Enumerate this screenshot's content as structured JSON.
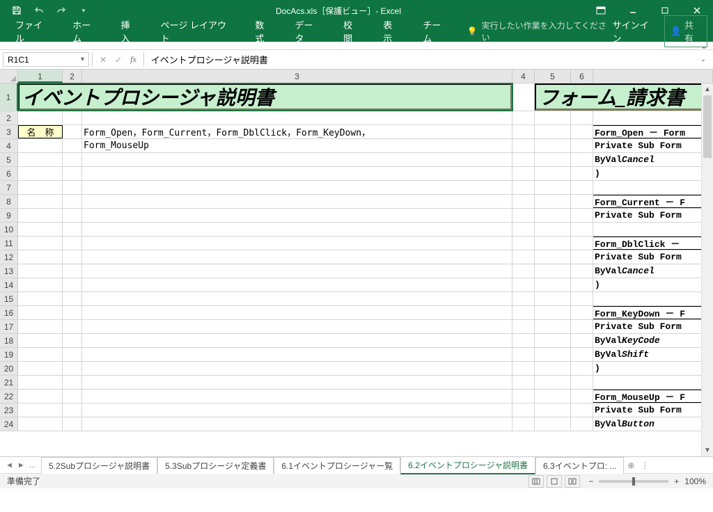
{
  "app": {
    "title": "DocAcs.xls［保護ビュー］- Excel",
    "signin": "サインイン",
    "share": "共有"
  },
  "ribbon": {
    "tabs": [
      "ファイル",
      "ホーム",
      "挿入",
      "ページ レイアウト",
      "数式",
      "データ",
      "校閲",
      "表示",
      "チーム"
    ],
    "tellme": "実行したい作業を入力してください"
  },
  "namebox": {
    "value": "R1C1"
  },
  "formula": {
    "value": "イベントプロシージャ説明書"
  },
  "columns": [
    "1",
    "2",
    "3",
    "4",
    "5",
    "6",
    ""
  ],
  "row_count": 24,
  "cells": {
    "title_main": "イベントプロシージャ説明書",
    "title_right": "フォーム_請求書",
    "label_r3c1": "名　称",
    "r3c3": "Form_Open，Form_Current，Form_DblClick，Form_KeyDown，",
    "r4c3": "Form_MouseUp",
    "right": {
      "r3": "Form_Open － Form",
      "r4": "Private Sub Form",
      "r5_pre": "    ByVal ",
      "r5_it": "Cancel",
      "r6": ")",
      "r8": "Form_Current － F",
      "r9": "Private Sub Form",
      "r11": "Form_DblClick － ",
      "r12": "Private Sub Form",
      "r13_pre": "    ByVal ",
      "r13_it": "Cancel",
      "r14": ")",
      "r16": "Form_KeyDown － F",
      "r17": "Private Sub Form",
      "r18_pre": "    ByVal ",
      "r18_it": "KeyCode",
      "r19_pre": "    ByVal ",
      "r19_it": "Shift",
      "r20": ")",
      "r22": "Form_MouseUp － F",
      "r23": "Private Sub Form",
      "r24_pre": "    ByVal ",
      "r24_it": "Button"
    }
  },
  "sheets": {
    "tabs": [
      "5.2Subプロシージャ説明書",
      "5.3Subプロシージャ定義書",
      "6.1イベントプロシージャー覧",
      "6.2イベントプロシージャ説明書",
      "6.3イベントプロ: ..."
    ],
    "active_index": 3,
    "ellipsis": "..."
  },
  "status": {
    "ready": "準備完了",
    "zoom": "100%"
  }
}
